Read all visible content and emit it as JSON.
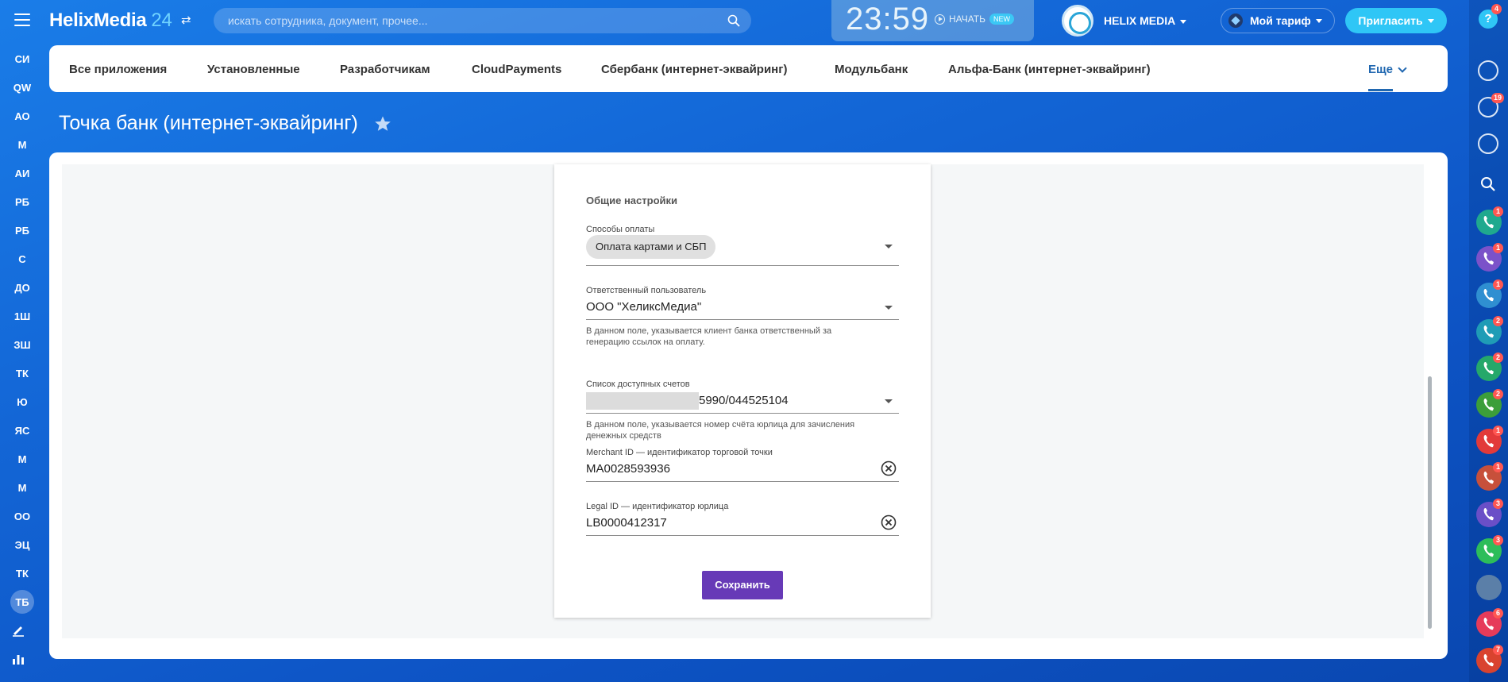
{
  "header": {
    "logo_text": "HelixMedia",
    "logo_num": "24",
    "search_placeholder": "искать сотрудника, документ, прочее...",
    "clock": "23:59",
    "start_label": "НАЧАТЬ",
    "new_badge": "NEW",
    "company_name": "HELIX MEDIA",
    "tariff_label": "Мой тариф",
    "invite_label": "Пригласить"
  },
  "left_rail": [
    "СИ",
    "QW",
    "АО",
    "М",
    "АИ",
    "РБ",
    "РБ",
    "С",
    "ДО",
    "1Ш",
    "ЗШ",
    "ТК",
    "Ю",
    "ЯС",
    "М",
    "М",
    "ОО",
    "ЭЦ",
    "ТК",
    "ТБ"
  ],
  "right_rail": {
    "help_badge": "4",
    "notify_badge": "19",
    "chat_badges": [
      "1",
      "1",
      "1",
      "2",
      "2",
      "2",
      "1",
      "1",
      "3",
      "3",
      "",
      "6",
      "7"
    ]
  },
  "tabs": [
    "Все приложения",
    "Установленные",
    "Разработчикам",
    "CloudPayments",
    "Сбербанк (интернет-эквайринг)",
    "Модульбанк",
    "Альфа-Банк (интернет-эквайринг)",
    "Еще"
  ],
  "page": {
    "title": "Точка банк (интернет-эквайринг)"
  },
  "form": {
    "section_title": "Общие настройки",
    "payment_methods_label": "Способы оплаты",
    "payment_methods_value": "Оплата картами и СБП",
    "responsible_label": "Ответственный пользователь",
    "responsible_value": "ООО \"ХеликсМедиа\"",
    "responsible_hint": "В данном поле, указывается клиент банка ответственный за генерацию ссылок на оплату.",
    "accounts_label": "Список доступных счетов",
    "accounts_value": "5990/044525104",
    "accounts_hint": "В данном поле, указывается номер счёта юрлица для зачисления денежных средств",
    "merchant_label": "Merchant ID — идентификатор торговой точки",
    "merchant_value": "MA0028593936",
    "legal_label": "Legal ID — идентификатор юрлица",
    "legal_value": "LB0000412317",
    "save_label": "Сохранить"
  },
  "colors": {
    "accent": "#2fc6f6",
    "save_button": "#673ab7",
    "active_tab": "#2067b0",
    "badge": "#ff5752"
  }
}
